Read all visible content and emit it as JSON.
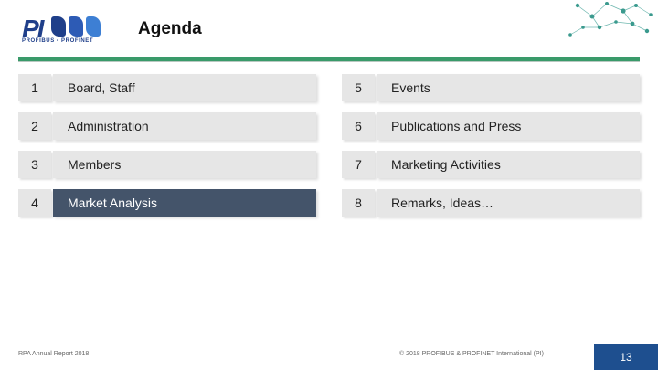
{
  "header": {
    "logo_text": "PI",
    "logo_tagline": "PROFIBUS • PROFINET",
    "title": "Agenda"
  },
  "agenda": {
    "left": [
      {
        "num": "1",
        "label": "Board, Staff",
        "active": false
      },
      {
        "num": "2",
        "label": "Administration",
        "active": false
      },
      {
        "num": "3",
        "label": "Members",
        "active": false
      },
      {
        "num": "4",
        "label": "Market Analysis",
        "active": true
      }
    ],
    "right": [
      {
        "num": "5",
        "label": "Events",
        "active": false
      },
      {
        "num": "6",
        "label": "Publications and Press",
        "active": false
      },
      {
        "num": "7",
        "label": "Marketing Activities",
        "active": false
      },
      {
        "num": "8",
        "label": "Remarks, Ideas…",
        "active": false
      }
    ]
  },
  "footer": {
    "left": "RPA Annual Report 2018",
    "center": "© 2018 PROFIBUS & PROFINET International (PI)",
    "page": "13"
  },
  "colors": {
    "accent_green": "#3a9a6a",
    "active_row": "#44546a",
    "page_badge": "#1e4f8f",
    "brand_blue": "#1f3f8a"
  }
}
